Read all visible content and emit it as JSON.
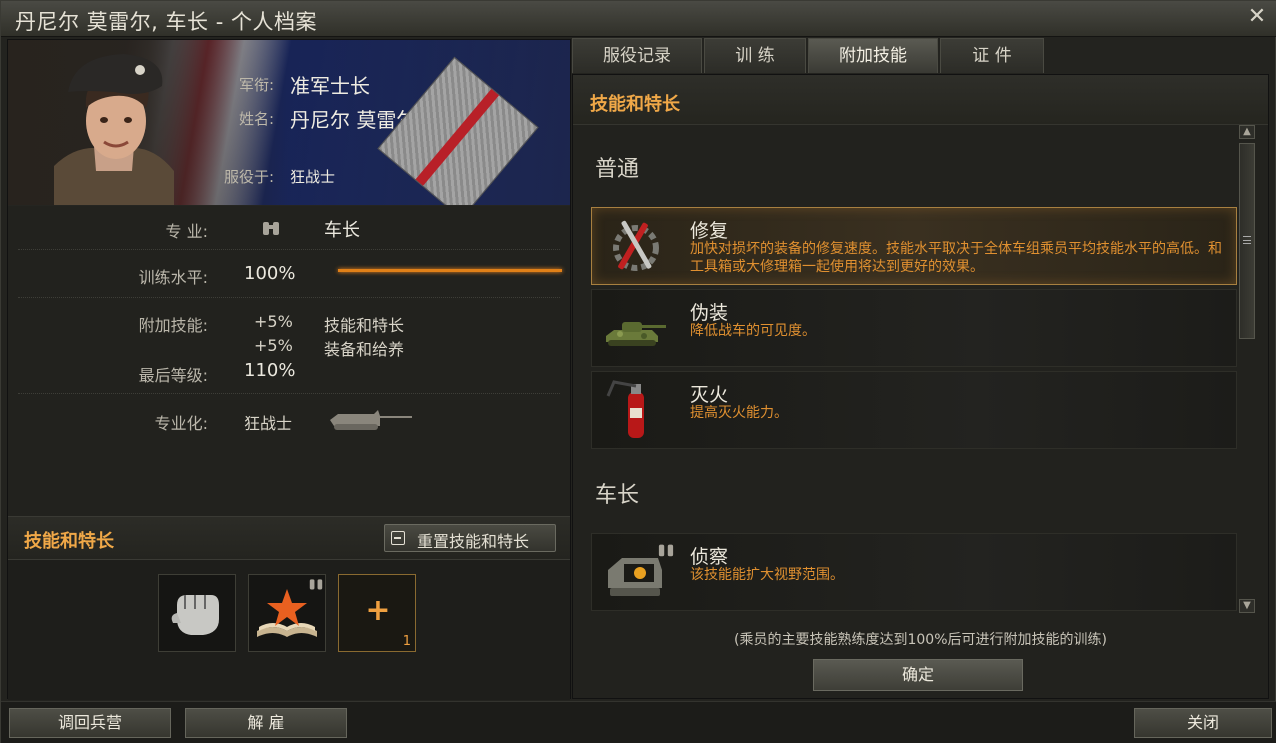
{
  "window": {
    "title": "丹尼尔 莫雷尔, 车长 - 个人档案",
    "close_icon": "✕"
  },
  "profile": {
    "rank_label": "军衔:",
    "rank_value": "准军士长",
    "name_label": "姓名:",
    "name_value": "丹尼尔 莫雷尔",
    "serves_label": "服役于:",
    "serves_value": "狂战士"
  },
  "stats": {
    "specialty_label": "专  业:",
    "specialty_value": "车长",
    "training_label": "训练水平:",
    "training_value": "100%",
    "training_progress": 1.0,
    "bonus_label": "附加技能:",
    "bonus_rows": [
      {
        "value": "+5%",
        "name": "技能和特长"
      },
      {
        "value": "+5%",
        "name": "装备和给养"
      }
    ],
    "final_label": "最后等级:",
    "final_value": "110%",
    "specialization_label": "专业化:",
    "specialization_value": "狂战士"
  },
  "skills_panel": {
    "title": "技能和特长",
    "reset_label": "重置技能和特长",
    "add_slot_symbol": "+",
    "add_slot_count": "1"
  },
  "tabs": [
    {
      "label": "服役记录",
      "active": false
    },
    {
      "label": "训  练",
      "active": false
    },
    {
      "label": "附加技能",
      "active": true
    },
    {
      "label": "证  件",
      "active": false
    }
  ],
  "right": {
    "header": "技能和特长",
    "group_common": "普通",
    "group_commander": "车长",
    "skills": [
      {
        "name": "修复",
        "desc": "加快对损坏的装备的修复速度。技能水平取决于全体车组乘员平均技能水平的高低。和工具箱或大修理箱一起使用将达到更好的效果。",
        "selected": true
      },
      {
        "name": "伪装",
        "desc": "降低战车的可见度。",
        "selected": false
      },
      {
        "name": "灭火",
        "desc": "提高灭火能力。",
        "selected": false
      },
      {
        "name": "侦察",
        "desc": "该技能能扩大视野范围。",
        "selected": false
      }
    ],
    "note": "(乘员的主要技能熟练度达到100%后可进行附加技能的训练)",
    "ok_label": "确定"
  },
  "bottom": {
    "barracks_label": "调回兵营",
    "dismiss_label": "解  雇",
    "close_label": "关闭"
  }
}
